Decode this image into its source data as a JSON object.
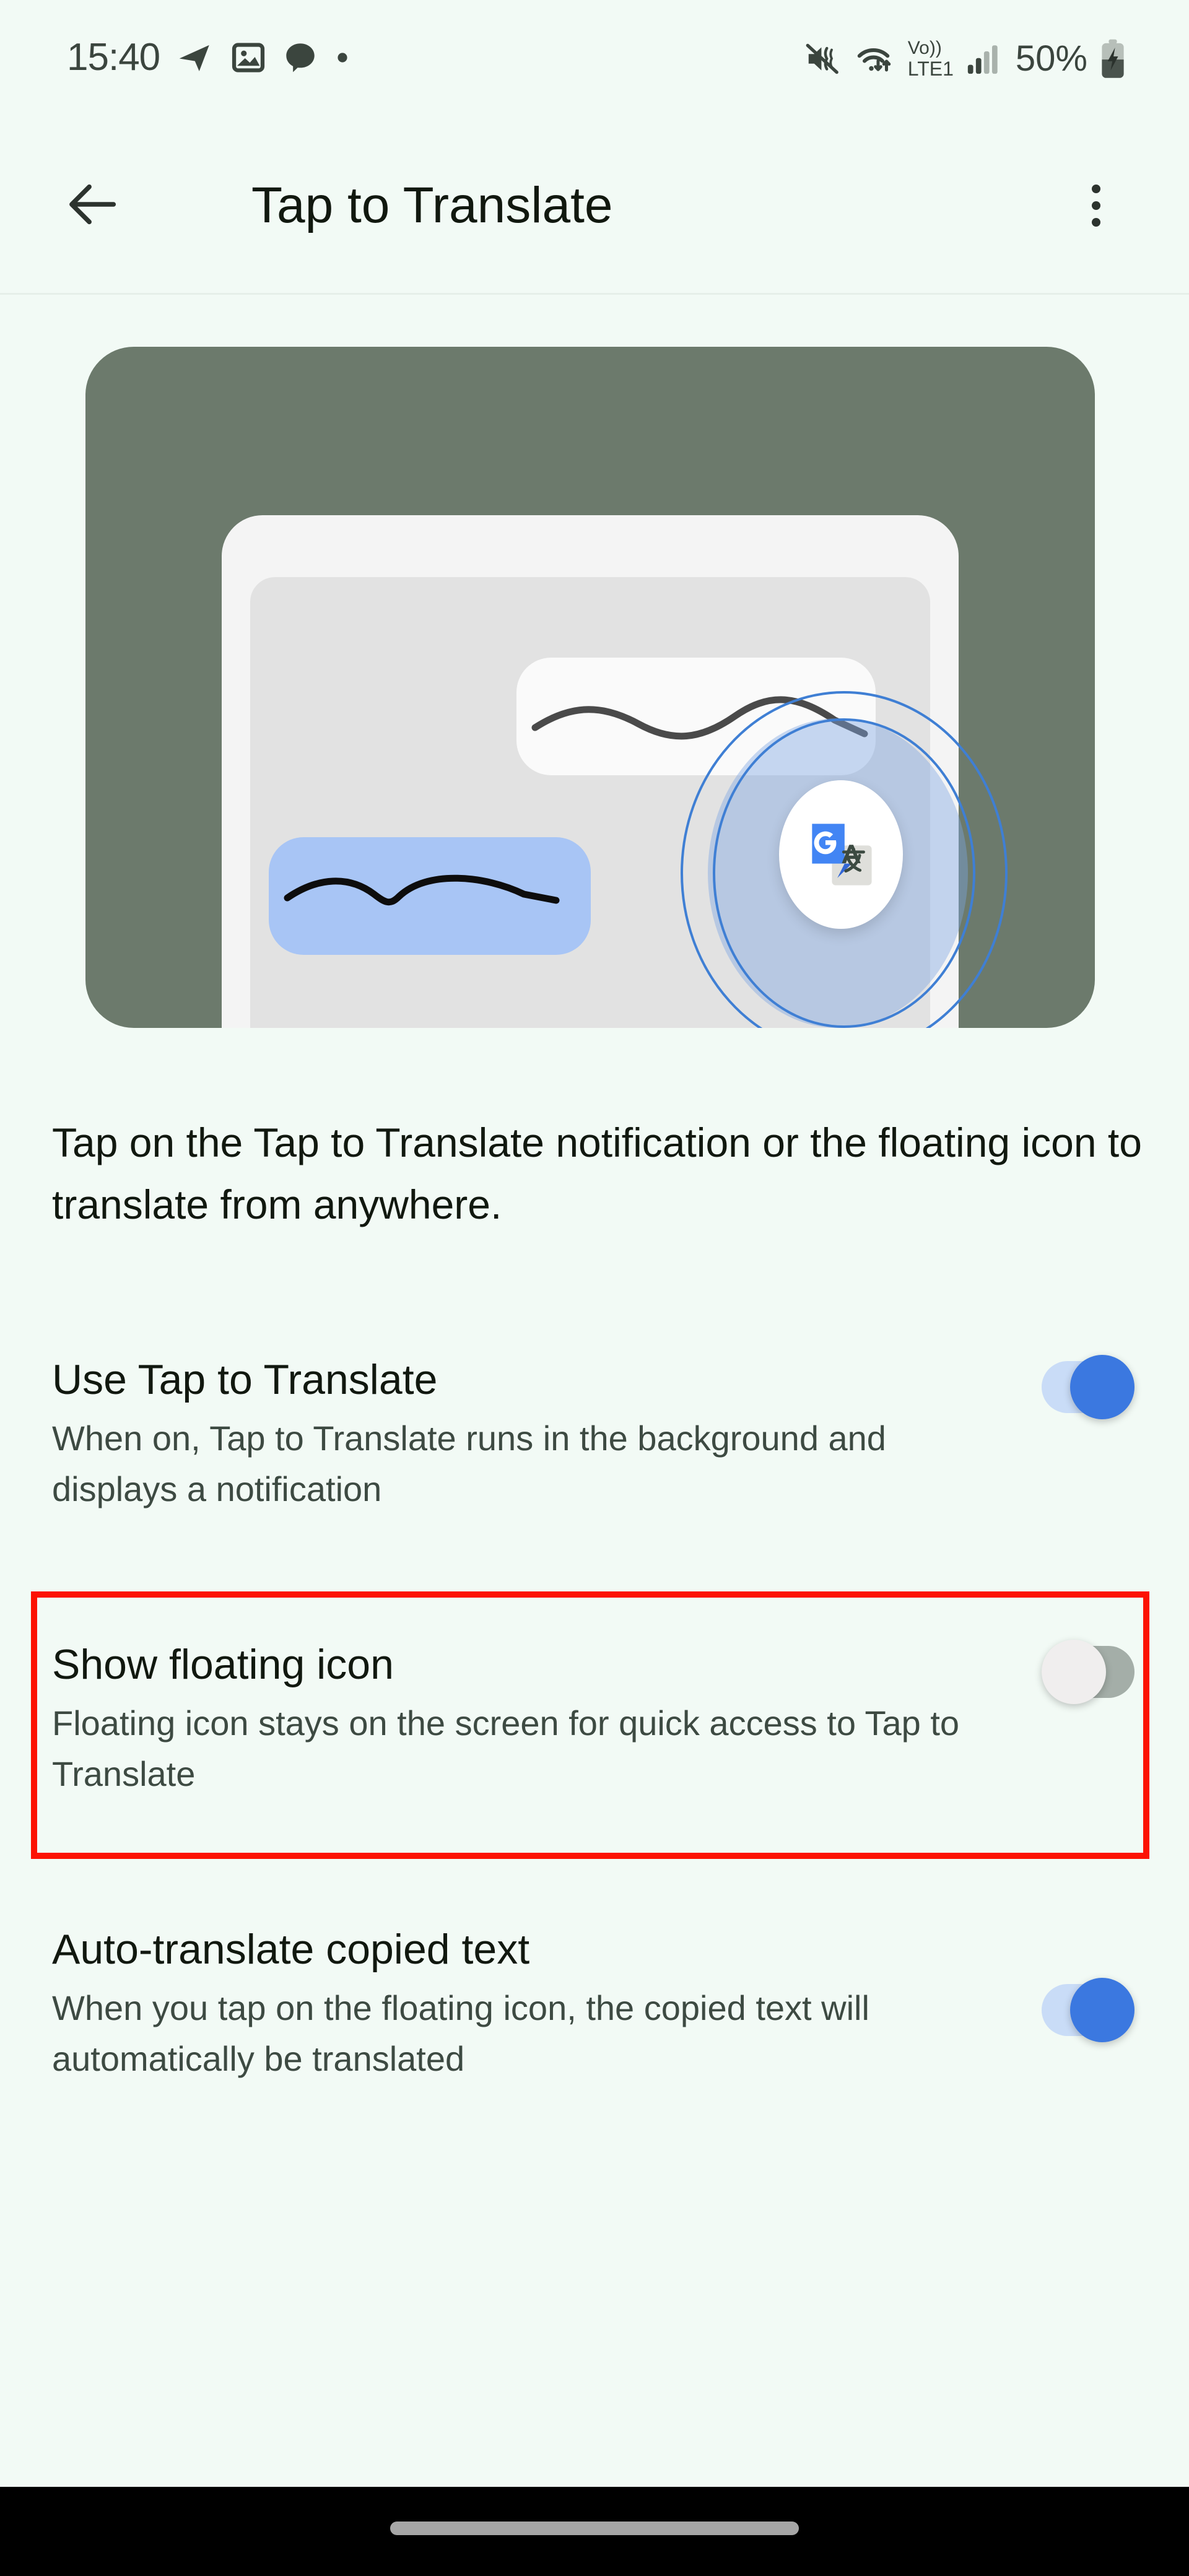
{
  "status_bar": {
    "time": "15:40",
    "battery_percent": "50%",
    "network_label_top": "Vo))",
    "network_label_bottom": "LTE1",
    "left_icons": [
      "send-icon",
      "image-icon",
      "chat-bubble-icon",
      "dot-icon"
    ],
    "right_icons": [
      "mute-vibrate-icon",
      "wifi-data-icon",
      "volte-icon",
      "signal-bars-icon",
      "battery-charging-icon"
    ]
  },
  "app_bar": {
    "title": "Tap to Translate",
    "back_icon": "arrow-left-icon",
    "overflow_icon": "more-vertical-icon"
  },
  "hero": {
    "alt": "Illustration of phone with Google Translate floating icon",
    "fab_icon": "google-translate-icon",
    "fab_letter": "G",
    "fab_glyph": "文"
  },
  "description": "Tap on the Tap to Translate notification or the floating icon to translate from anywhere.",
  "settings": [
    {
      "title": "Use Tap to Translate",
      "subtitle": "When on, Tap to Translate runs in the background and displays a notification",
      "state": "on",
      "highlighted": false
    },
    {
      "title": "Show floating icon",
      "subtitle": "Floating icon stays on the screen for quick access to Tap to Translate",
      "state": "off",
      "highlighted": true
    },
    {
      "title": "Auto-translate copied text",
      "subtitle": "When you tap on the floating icon, the copied text will automatically be translated",
      "state": "on",
      "highlighted": false
    }
  ],
  "colors": {
    "page_background": "#f2faf5",
    "hero_background": "#6c7a6c",
    "accent_blue": "#3b78e0",
    "track_on": "#c9dcf7",
    "track_off": "#a4aea8",
    "highlight_border": "#fc1203",
    "title_text": "#11180f",
    "subtitle_text": "#3d4a42",
    "nav_bar": "#000000"
  },
  "nav_bar": {
    "gesture_pill": "home-gesture-pill"
  }
}
